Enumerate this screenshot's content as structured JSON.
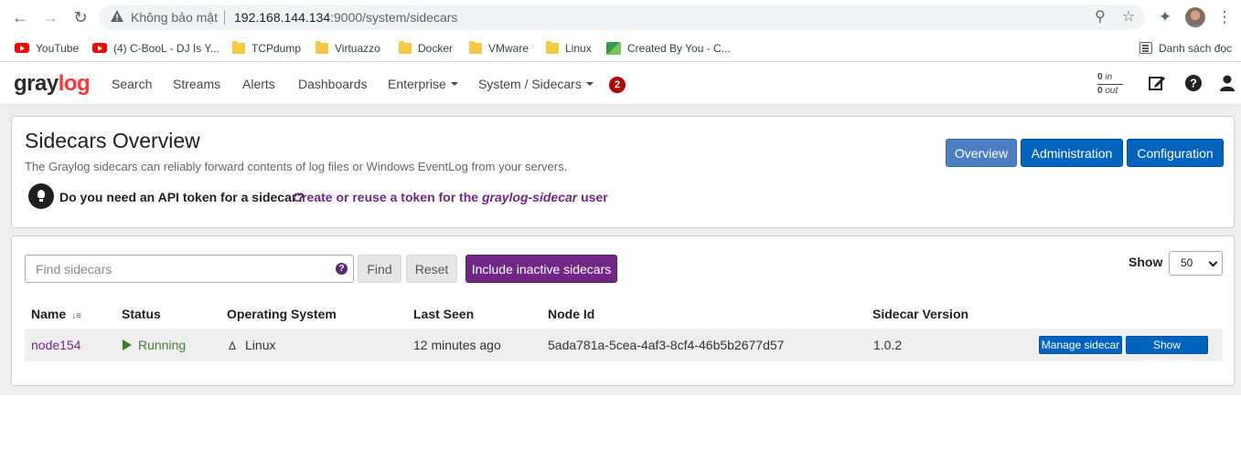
{
  "browser": {
    "insecure_label": "Không bảo mật",
    "url_host": "192.168.144.134",
    "url_path": ":9000/system/sidecars",
    "bookmarks": [
      {
        "label": "YouTube",
        "icon": "youtube-icon"
      },
      {
        "label": "(4) C-BooL - DJ Is Y...",
        "icon": "youtube-icon"
      },
      {
        "label": "TCPdump",
        "icon": "folder-icon"
      },
      {
        "label": "Virtuazzo",
        "icon": "folder-icon"
      },
      {
        "label": "Docker",
        "icon": "folder-icon"
      },
      {
        "label": "VMware",
        "icon": "folder-icon"
      },
      {
        "label": "Linux",
        "icon": "folder-icon"
      },
      {
        "label": "Created By You - C...",
        "icon": "created-by-you-icon"
      }
    ],
    "reading_list": "Danh sách đọc"
  },
  "navbar": {
    "logo_gray": "gray",
    "logo_red": "log",
    "items": {
      "search": "Search",
      "streams": "Streams",
      "alerts": "Alerts",
      "dashboards": "Dashboards",
      "enterprise": "Enterprise",
      "system": "System / Sidecars"
    },
    "notification_count": "2",
    "throughput_in": "0",
    "throughput_in_label": "in",
    "throughput_out": "0",
    "throughput_out_label": "out"
  },
  "header": {
    "title": "Sidecars Overview",
    "description": "The Graylog sidecars can reliably forward contents of log files or Windows EventLog from your servers.",
    "token_question": "Do you need an API token for a sidecar?",
    "token_link_prefix": "Create or reuse a token for the",
    "token_link_user": "graylog-sidecar",
    "token_link_suffix": "user",
    "buttons": {
      "overview": "Overview",
      "administration": "Administration",
      "configuration": "Configuration"
    }
  },
  "filter": {
    "placeholder": "Find sidecars",
    "find": "Find",
    "reset": "Reset",
    "include_inactive": "Include inactive sidecars",
    "show_label": "Show",
    "page_size": "50"
  },
  "table": {
    "columns": [
      "Name",
      "Status",
      "Operating System",
      "Last Seen",
      "Node Id",
      "Sidecar Version"
    ],
    "rows": [
      {
        "name": "node154",
        "status": "Running",
        "os": "Linux",
        "last_seen": "12 minutes ago",
        "node_id": "5ada781a-5cea-4af3-8cf4-46b5b2677d57",
        "version": "1.0.2",
        "manage": "Manage sidecar",
        "show_messages": "Show messages"
      }
    ]
  },
  "colors": {
    "primary": "#0063be",
    "purple": "#702785",
    "badge": "#ad0707",
    "running": "#3e7b27"
  }
}
